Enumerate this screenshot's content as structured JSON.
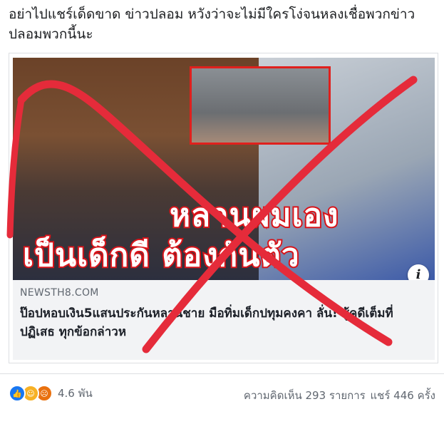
{
  "post": {
    "text": "อย่าไปแชร์เด็ดขาด ข่าวปลอม หวังว่าจะไม่มีใครโง่จนหลงเชื่อพวกข่าวปลอมพวกนี้นะ"
  },
  "link_preview": {
    "image_caption_line1": "หลานผมเอง",
    "image_caption_line2": "เป็นเด็กดี ต้องกันตัว",
    "domain": "NEWSTH8.COM",
    "title": "ป๊อปหอบเงิน5แสนประกันหลานชาย มือทิ่มเด็กปทุมคงคา ลั่น! สู้คดีเต็มที่ ปฏิเสธ ทุกข้อกล่าวห",
    "info_glyph": "i"
  },
  "reactions": {
    "icons": [
      "like-icon",
      "haha-icon",
      "angry-icon"
    ],
    "count": "4.6 พัน"
  },
  "stats": {
    "comments": "ความคิดเห็น 293 รายการ",
    "shares": "แชร์ 446 ครั้ง"
  },
  "colors": {
    "x_mark": "#e52b3a",
    "link_bg": "#f2f3f5",
    "like": "#1877f2",
    "caption_stroke": "#d8141a"
  }
}
